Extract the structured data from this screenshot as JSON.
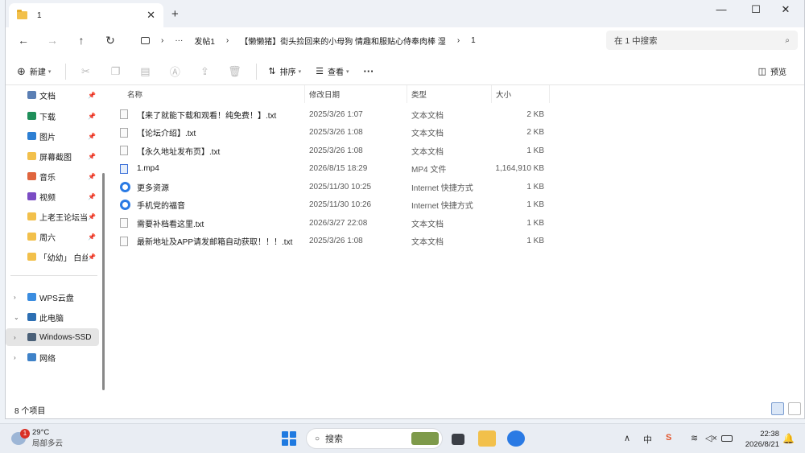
{
  "window": {
    "tab_title": "1",
    "tab_close": "✕",
    "new_tab": "+",
    "controls": {
      "minimize": "—",
      "maximize": "☐",
      "close": "✕"
    }
  },
  "nav": {
    "back": "←",
    "forward": "→",
    "up": "↑",
    "refresh": "↻",
    "breadcrumb": [
      "›",
      "···",
      "发帖1",
      "›",
      "【懒懒猪】街头捡回来的小母狗 情趣和服贴心侍奉肉棒 湿",
      "›",
      "1"
    ],
    "search_placeholder": "在 1 中搜索"
  },
  "toolbar": {
    "new_label": "新建",
    "sort_label": "排序",
    "view_label": "查看",
    "more_label": "···",
    "preview_label": "预览",
    "icons": [
      "cut-icon",
      "copy-icon",
      "paste-icon",
      "rename-icon",
      "share-icon",
      "delete-icon"
    ]
  },
  "sidebar": {
    "items": [
      {
        "label": "文档",
        "icon": "documents-icon",
        "color": "#5b7fb4",
        "pin": true
      },
      {
        "label": "下载",
        "icon": "download-icon",
        "color": "#1f8f5a",
        "pin": true
      },
      {
        "label": "图片",
        "icon": "pictures-icon",
        "color": "#2d7fd3",
        "pin": true
      },
      {
        "label": "屏幕截图",
        "icon": "folder-icon",
        "color": "#f2c04b",
        "pin": true
      },
      {
        "label": "音乐",
        "icon": "music-icon",
        "color": "#e0653e",
        "pin": true
      },
      {
        "label": "视频",
        "icon": "videos-icon",
        "color": "#7b4cc4",
        "pin": true
      },
      {
        "label": "上老王论坛当",
        "icon": "folder-icon",
        "color": "#f2c04b",
        "pin": true
      },
      {
        "label": "周六",
        "icon": "folder-icon",
        "color": "#f2c04b",
        "pin": true
      },
      {
        "label": "「幼幼」 白丝",
        "icon": "folder-icon",
        "color": "#f2c04b",
        "pin": true
      },
      {
        "label": "WPS云盘",
        "icon": "cloud-icon",
        "color": "#3b8de0",
        "pin": false,
        "chevron": "›"
      },
      {
        "label": "此电脑",
        "icon": "computer-icon",
        "color": "#2d6fb3",
        "pin": false,
        "chevron": "⌄"
      },
      {
        "label": "Windows-SSD",
        "icon": "drive-icon",
        "color": "#4a6078",
        "pin": false,
        "chevron": "›",
        "selected": true
      },
      {
        "label": "网络",
        "icon": "network-icon",
        "color": "#3f82c8",
        "pin": false,
        "chevron": "›"
      }
    ]
  },
  "table": {
    "columns": [
      "名称",
      "修改日期",
      "类型",
      "大小"
    ],
    "rows": [
      {
        "name": "【来了就能下载和观看！纯免费！】.txt",
        "date": "2025/3/26 1:07",
        "type": "文本文档",
        "size": "2 KB",
        "kind": "txt"
      },
      {
        "name": "【论坛介绍】.txt",
        "date": "2025/3/26 1:08",
        "type": "文本文档",
        "size": "2 KB",
        "kind": "txt"
      },
      {
        "name": "【永久地址发布页】.txt",
        "date": "2025/3/26 1:08",
        "type": "文本文档",
        "size": "1 KB",
        "kind": "txt"
      },
      {
        "name": "1.mp4",
        "date": "2026/8/15 18:29",
        "type": "MP4 文件",
        "size": "1,164,910 KB",
        "kind": "mp4"
      },
      {
        "name": "更多资源",
        "date": "2025/11/30 10:25",
        "type": "Internet 快捷方式",
        "size": "1 KB",
        "kind": "lnk"
      },
      {
        "name": "手机党的福音",
        "date": "2025/11/30 10:26",
        "type": "Internet 快捷方式",
        "size": "1 KB",
        "kind": "lnk"
      },
      {
        "name": "需要补档看这里.txt",
        "date": "2026/3/27 22:08",
        "type": "文本文档",
        "size": "1 KB",
        "kind": "txt"
      },
      {
        "name": "最新地址及APP请发邮箱自动获取！！！.txt",
        "date": "2025/3/26 1:08",
        "type": "文本文档",
        "size": "1 KB",
        "kind": "txt"
      }
    ]
  },
  "status": {
    "count": "8 个项目"
  },
  "taskbar": {
    "weather_badge": "1",
    "temperature": "29°C",
    "weather_desc": "局部多云",
    "search_label": "搜索",
    "search_icon": "🔍",
    "tray": {
      "chevron": "∧",
      "ime": "中",
      "wifi": "wifi-icon",
      "volume": "volume-icon",
      "battery": "battery-icon"
    },
    "time": "22:38",
    "date": "2026/8/21"
  }
}
